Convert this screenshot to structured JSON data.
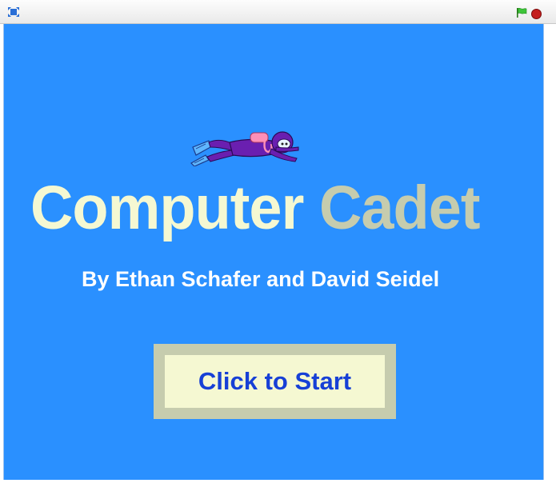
{
  "controls": {
    "fullscreen_icon": "fullscreen-icon",
    "green_flag_icon": "green-flag-icon",
    "stop_icon": "stop-icon"
  },
  "stage": {
    "background_color": "#2a90ff",
    "sprite": "scuba-diver",
    "title_word1": "Computer",
    "title_word2": "Cadet",
    "title_word1_color": "#f5f8d2",
    "title_word2_color": "#c6ccae",
    "byline": "By Ethan Schafer and David Seidel",
    "start_button_label": "Click to Start",
    "start_button_text_color": "#1740d6"
  }
}
